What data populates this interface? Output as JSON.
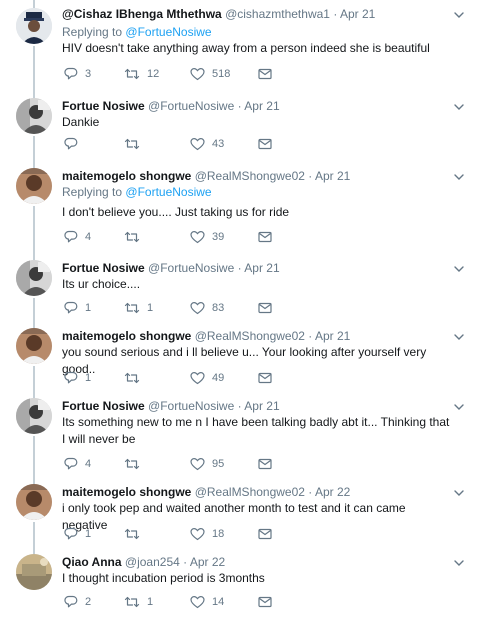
{
  "tweets": [
    {
      "name": "@Cishaz IBhenga Mthethwa",
      "handle": "@cishazmthethwa1",
      "time": "Apr 21",
      "replying_prefix": "Replying to",
      "replying_to": "@FortueNosiwe",
      "text": "HIV doesn't take anything away from a person indeed she is beautiful",
      "replies": "3",
      "retweets": "12",
      "likes": "518"
    },
    {
      "name": "Fortue Nosiwe",
      "handle": "@FortueNosiwe",
      "time": "Apr 21",
      "text": "Dankie",
      "replies": "",
      "retweets": "",
      "likes": "43"
    },
    {
      "name": "maitemogelo shongwe",
      "handle": "@RealMShongwe02",
      "time": "Apr 21",
      "replying_prefix": "Replying to",
      "replying_to": "@FortueNosiwe",
      "text": "I don't believe you.... Just taking us for ride",
      "replies": "4",
      "retweets": "",
      "likes": "39"
    },
    {
      "name": "Fortue Nosiwe",
      "handle": "@FortueNosiwe",
      "time": "Apr 21",
      "text": "Its ur choice....",
      "replies": "1",
      "retweets": "1",
      "likes": "83"
    },
    {
      "name": "maitemogelo shongwe",
      "handle": "@RealMShongwe02",
      "time": "Apr 21",
      "text": "you sound serious and i ll believe u... Your looking after yourself very good..",
      "replies": "1",
      "retweets": "",
      "likes": "49"
    },
    {
      "name": "Fortue Nosiwe",
      "handle": "@FortueNosiwe",
      "time": "Apr 21",
      "text": "Its something new to me n I have been talking badly abt it...  Thinking that I will never be",
      "replies": "4",
      "retweets": "",
      "likes": "95"
    },
    {
      "name": "maitemogelo shongwe",
      "handle": "@RealMShongwe02",
      "time": "Apr 22",
      "text": "i only took pep and waited another month to test and it can came negative",
      "replies": "1",
      "retweets": "",
      "likes": "18"
    },
    {
      "name": "Qiao Anna",
      "handle": "@joan254",
      "time": "Apr 22",
      "text": "I thought incubation period is 3months",
      "replies": "2",
      "retweets": "1",
      "likes": "14"
    }
  ],
  "icons": {
    "reply": "reply-icon",
    "retweet": "retweet-icon",
    "like": "heart-icon",
    "dm": "envelope-icon",
    "more": "chevron-down-icon"
  },
  "colors": {
    "text": "#14171a",
    "muted": "#657786",
    "link": "#1da1f2",
    "thread_line": "#c4cfd6"
  }
}
